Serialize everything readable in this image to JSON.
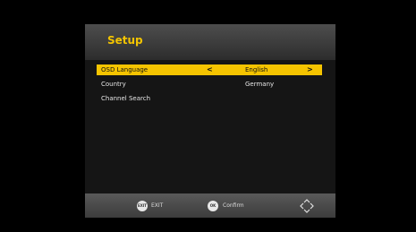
{
  "header": {
    "title": "Setup"
  },
  "menu": {
    "items": [
      {
        "label": "OSD Language",
        "value": "English",
        "arrow_left": "<",
        "arrow_right": ">"
      },
      {
        "label": "Country",
        "value": "Germany"
      },
      {
        "label": "Channel Search",
        "value": ""
      }
    ]
  },
  "footer": {
    "exit_key": "EXIT",
    "exit_label": "EXIT",
    "ok_key": "OK",
    "ok_label": "Confirm",
    "nav_icon": "dpad-icon"
  },
  "colors": {
    "accent": "#f5c400",
    "title": "#f3c400",
    "panel": "#151515"
  }
}
